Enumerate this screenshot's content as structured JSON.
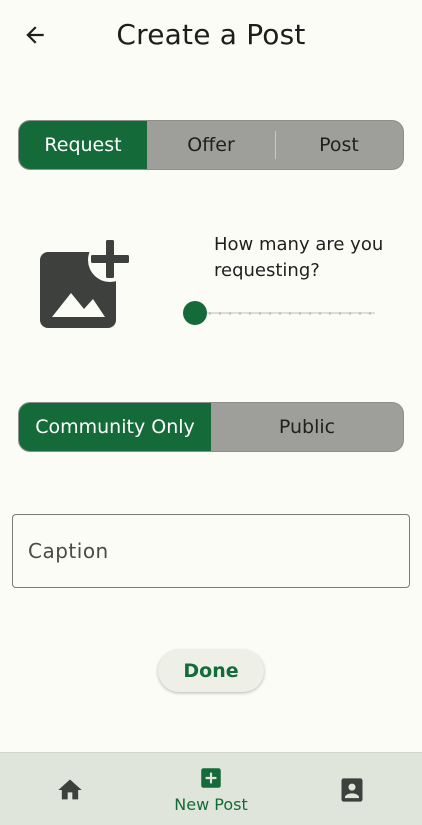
{
  "header": {
    "back_icon": "arrow-left-icon",
    "title": "Create a Post"
  },
  "post_type": {
    "options": [
      "Request",
      "Offer",
      "Post"
    ],
    "selected": "Request"
  },
  "image_picker": {
    "icon": "add-photo-icon"
  },
  "quantity": {
    "question": "How many are you requesting?",
    "value": 0
  },
  "visibility": {
    "options": [
      "Community Only",
      "Public"
    ],
    "selected": "Community Only"
  },
  "caption": {
    "placeholder": "Caption",
    "value": ""
  },
  "done_label": "Done",
  "nav": {
    "items": [
      {
        "icon": "home-icon",
        "label": ""
      },
      {
        "icon": "add-box-icon",
        "label": "New Post"
      },
      {
        "icon": "profile-badge-icon",
        "label": ""
      }
    ],
    "active": "New Post"
  },
  "colors": {
    "accent": "#146b39",
    "background": "#fbfcf6",
    "segment_inactive": "#9e9e9b",
    "nav_background": "#dfe5da",
    "icon_dark": "#3d403c"
  }
}
